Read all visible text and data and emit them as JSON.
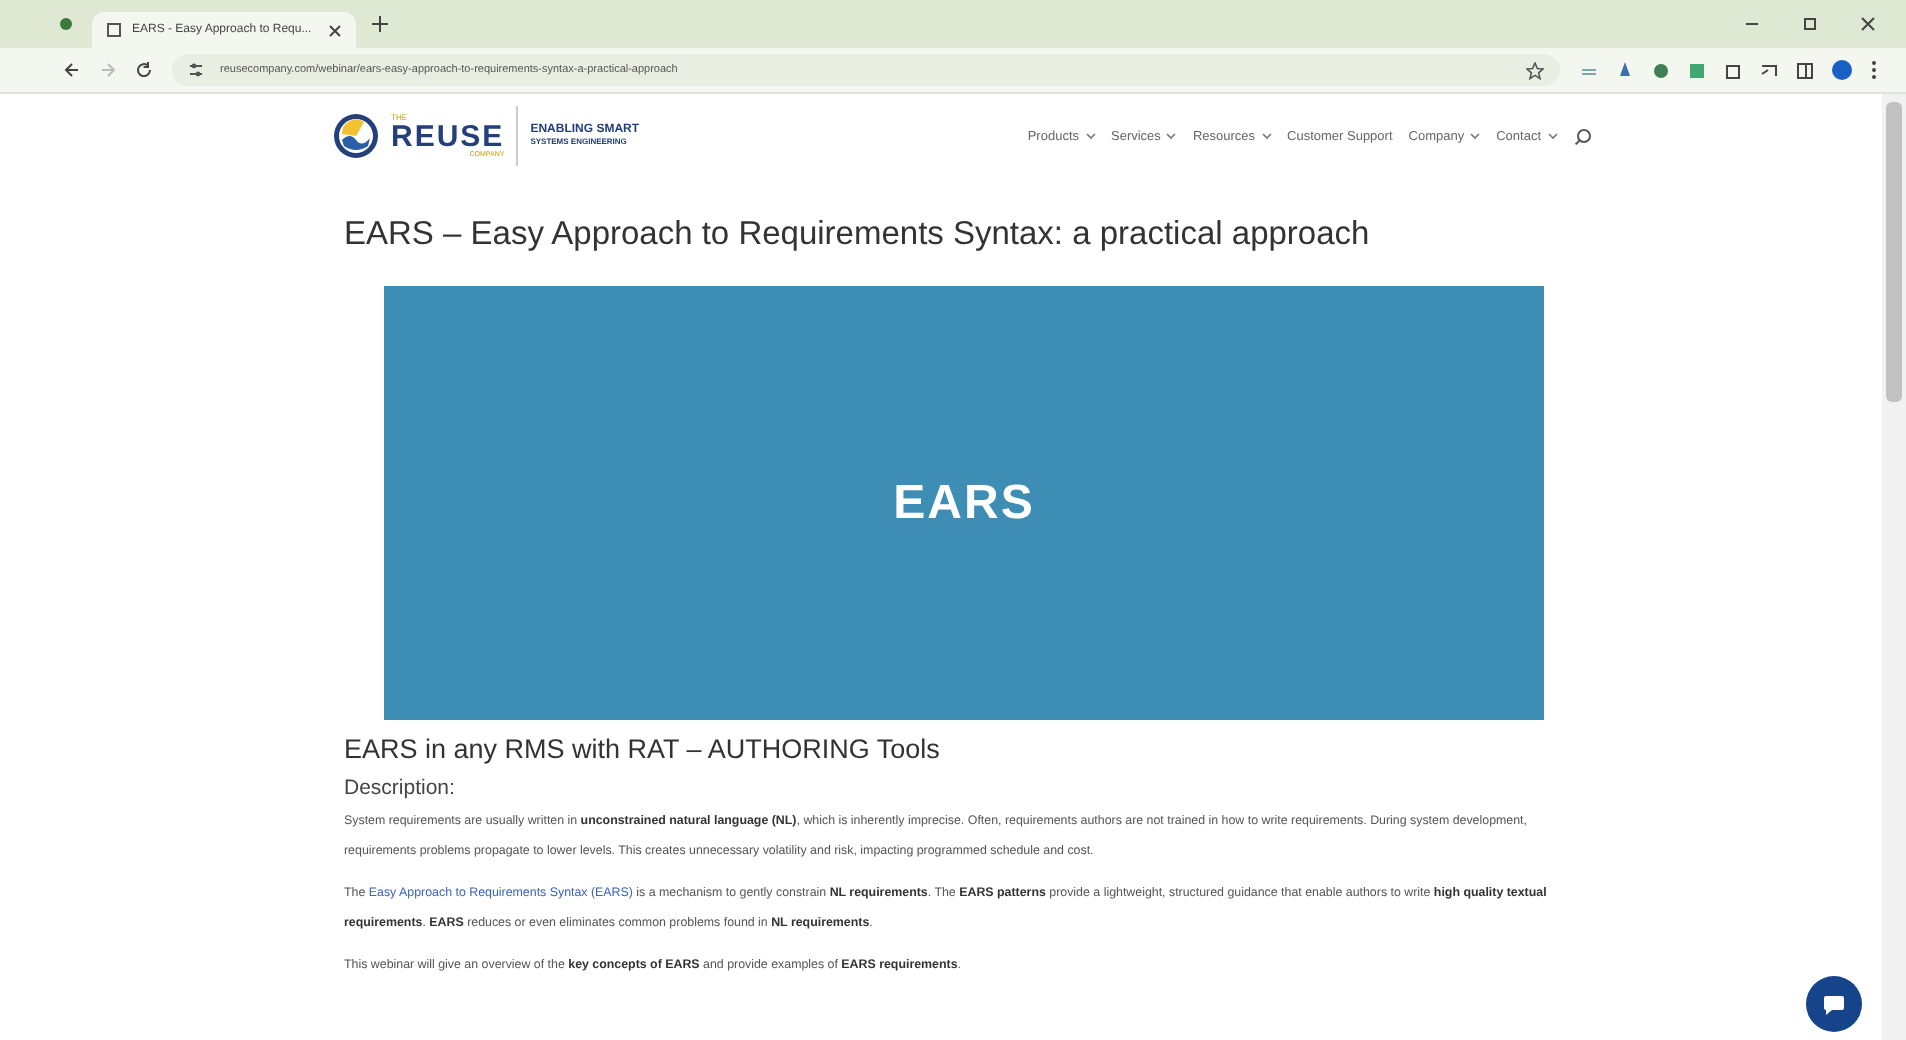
{
  "browser": {
    "tab_title": "EARS - Easy Approach to Requ...",
    "url": "reusecompany.com/webinar/ears-easy-approach-to-requirements-syntax-a-practical-approach"
  },
  "header": {
    "logo_small": "THE",
    "logo_text": "REUSE",
    "logo_sub": "COMPANY",
    "tagline_1": "ENABLING SMART",
    "tagline_2": "SYSTEMS ENGINEERING",
    "nav": [
      {
        "label": "Products",
        "has_menu": true
      },
      {
        "label": "Services",
        "has_menu": true
      },
      {
        "label": "Resources",
        "has_menu": true
      },
      {
        "label": "Customer Support",
        "has_menu": false
      },
      {
        "label": "Company",
        "has_menu": true
      },
      {
        "label": "Contact",
        "has_menu": true
      }
    ]
  },
  "article": {
    "title": "EARS – Easy Approach to Requirements Syntax: a practical approach",
    "banner_text": "EARS",
    "subtitle": "EARS in any RMS with RAT – AUTHORING Tools",
    "section_heading": "Description:",
    "paragraphs": [
      {
        "before": "System requirements are usually written in **unconstrained natural language (NL)**, which is inherently imprecise. Often, requirements authors are not trained in how to write requirements. During system development, requirements problems propagate to lower levels. This creates unnecessary volatility and risk, impacting programmed schedule and cost."
      },
      {
        "before": "The ",
        "link": "Easy Approach to Requirements Syntax (EARS)",
        "after": " is a mechanism to gently constrain **NL requirements**. The **EARS patterns** provide a lightweight, structured guidance that enable authors to write **high quality textual requirements**. **EARS** reduces or even eliminates common problems found in **NL requirements**."
      },
      {
        "before": "This webinar will give an overview of the **key concepts of EARS** and provide examples of **EARS requirements**."
      }
    ]
  }
}
